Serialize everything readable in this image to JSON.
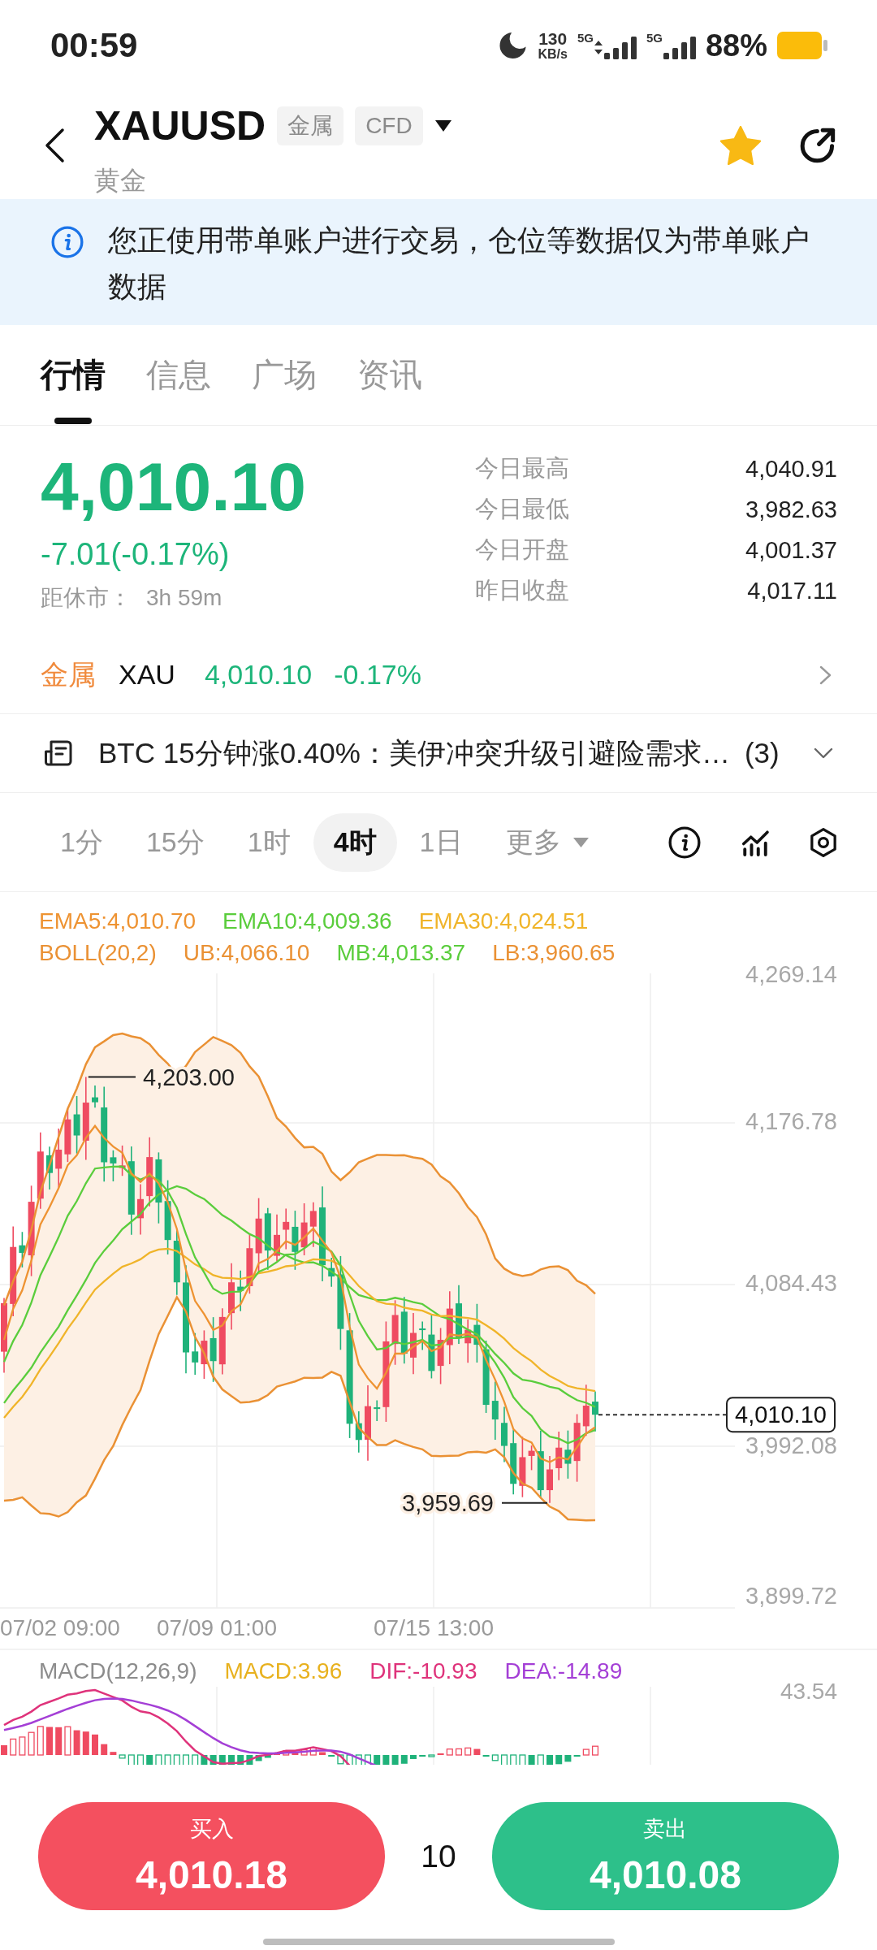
{
  "status_bar": {
    "time": "00:59",
    "speed_value": "130",
    "speed_unit": "KB/s",
    "sims": [
      {
        "network": "5G",
        "data_activity": true
      },
      {
        "network": "5G",
        "data_activity": false
      }
    ],
    "battery": "88%"
  },
  "header": {
    "symbol": "XAUUSD",
    "tags": [
      "金属",
      "CFD"
    ],
    "name": "黄金",
    "favorited": true
  },
  "notice": {
    "text": "您正使用带单账户进行交易，仓位等数据仅为带单账户数据"
  },
  "tabs": [
    {
      "label": "行情",
      "selected": true
    },
    {
      "label": "信息",
      "selected": false
    },
    {
      "label": "广场",
      "selected": false
    },
    {
      "label": "资讯",
      "selected": false
    }
  ],
  "quote": {
    "price": "4,010.10",
    "change": "-7.01(-0.17%)",
    "countdown_label": "距休市：",
    "countdown": "3h 59m",
    "stats": [
      {
        "label": "今日最高",
        "value": "4,040.91"
      },
      {
        "label": "今日最低",
        "value": "3,982.63"
      },
      {
        "label": "今日开盘",
        "value": "4,001.37"
      },
      {
        "label": "昨日收盘",
        "value": "4,017.11"
      }
    ]
  },
  "related": {
    "category": "金属",
    "symbol": "XAU",
    "price": "4,010.10",
    "change": "-0.17%"
  },
  "news": {
    "headline": "BTC 15分钟涨0.40%：美伊冲突升级引避险需求…",
    "count": "(3)"
  },
  "intervals": [
    {
      "label": "1分",
      "selected": false,
      "kind": "option"
    },
    {
      "label": "15分",
      "selected": false,
      "kind": "option"
    },
    {
      "label": "1时",
      "selected": false,
      "kind": "option"
    },
    {
      "label": "4时",
      "selected": true,
      "kind": "option"
    },
    {
      "label": "1日",
      "selected": false,
      "kind": "option"
    },
    {
      "label": "更多",
      "selected": false,
      "kind": "menu"
    }
  ],
  "chart": {
    "legend_rows": [
      {
        "items": [
          {
            "text": "EMA5:4,010.70",
            "color": "#ee9332"
          },
          {
            "text": "EMA10:4,009.36",
            "color": "#5acd3c"
          },
          {
            "text": "EMA30:4,024.51",
            "color": "#f0b429"
          }
        ]
      },
      {
        "items": [
          {
            "text": "BOLL(20,2)",
            "color": "#ea9134"
          },
          {
            "text": "UB:4,066.10",
            "color": "#ea9134"
          },
          {
            "text": "MB:4,013.37",
            "color": "#5acd3c"
          },
          {
            "text": "LB:3,960.65",
            "color": "#ea9134"
          }
        ]
      }
    ],
    "y_labels": [
      "4,269.14",
      "4,176.78",
      "4,084.43",
      "3,992.08",
      "3,899.72"
    ],
    "x_labels": [
      "07/02 09:00",
      "07/09 01:00",
      "07/15 13:00"
    ],
    "high_label": "4,203.00",
    "low_label": "3,959.69",
    "last_price": "4,010.10"
  },
  "macd": {
    "legend": [
      {
        "text": "MACD(12,26,9)",
        "color": "#8c8c8c"
      },
      {
        "text": "MACD:3.96",
        "color": "#e8b11e"
      },
      {
        "text": "DIF:-10.93",
        "color": "#df337b"
      },
      {
        "text": "DEA:-14.89",
        "color": "#a43fd6"
      }
    ],
    "axis_label": "43.54"
  },
  "trade": {
    "buttons": [
      {
        "kind": "buy",
        "label": "买入",
        "price": "4,010.18"
      },
      {
        "kind": "sell",
        "label": "卖出",
        "price": "4,010.08"
      }
    ],
    "quantity": "10"
  }
}
